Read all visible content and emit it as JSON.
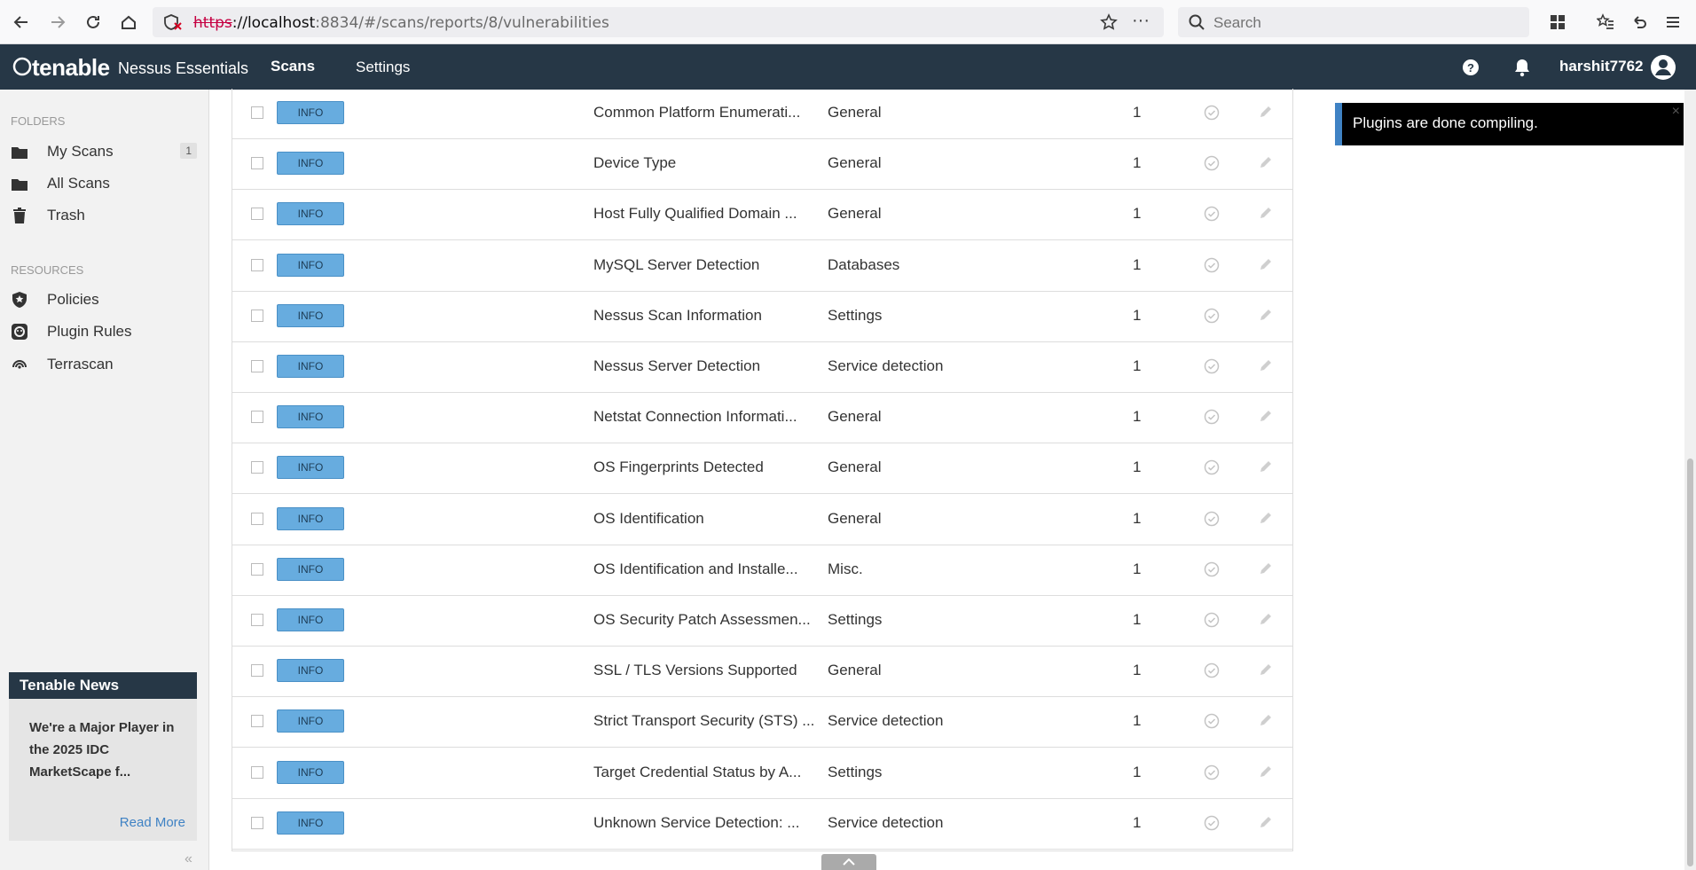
{
  "browser": {
    "url_scheme": "https",
    "url_host": "://localhost",
    "url_rest": ":8834/#/scans/reports/8/vulnerabilities",
    "search_placeholder": "Search"
  },
  "header": {
    "logo": "tenable",
    "product": "Nessus Essentials",
    "nav_scans": "Scans",
    "nav_settings": "Settings",
    "username": "harshit7762"
  },
  "sidebar": {
    "folders_label": "FOLDERS",
    "folders": [
      {
        "label": "My Scans",
        "badge": "1"
      },
      {
        "label": "All Scans"
      },
      {
        "label": "Trash"
      }
    ],
    "resources_label": "RESOURCES",
    "resources": [
      {
        "label": "Policies"
      },
      {
        "label": "Plugin Rules"
      },
      {
        "label": "Terrascan"
      }
    ]
  },
  "news": {
    "title": "Tenable News",
    "body": "We're a Major Player in the 2025 IDC MarketScape f...",
    "link": "Read More"
  },
  "toast": {
    "message": "Plugins are done compiling.",
    "close": "×"
  },
  "rows": [
    {
      "severity": "INFO",
      "name": "Common Platform Enumerati...",
      "family": "General",
      "count": "1"
    },
    {
      "severity": "INFO",
      "name": "Device Type",
      "family": "General",
      "count": "1"
    },
    {
      "severity": "INFO",
      "name": "Host Fully Qualified Domain ...",
      "family": "General",
      "count": "1"
    },
    {
      "severity": "INFO",
      "name": "MySQL Server Detection",
      "family": "Databases",
      "count": "1"
    },
    {
      "severity": "INFO",
      "name": "Nessus Scan Information",
      "family": "Settings",
      "count": "1"
    },
    {
      "severity": "INFO",
      "name": "Nessus Server Detection",
      "family": "Service detection",
      "count": "1"
    },
    {
      "severity": "INFO",
      "name": "Netstat Connection Informati...",
      "family": "General",
      "count": "1"
    },
    {
      "severity": "INFO",
      "name": "OS Fingerprints Detected",
      "family": "General",
      "count": "1"
    },
    {
      "severity": "INFO",
      "name": "OS Identification",
      "family": "General",
      "count": "1"
    },
    {
      "severity": "INFO",
      "name": "OS Identification and Installe...",
      "family": "Misc.",
      "count": "1"
    },
    {
      "severity": "INFO",
      "name": "OS Security Patch Assessmen...",
      "family": "Settings",
      "count": "1"
    },
    {
      "severity": "INFO",
      "name": "SSL / TLS Versions Supported",
      "family": "General",
      "count": "1"
    },
    {
      "severity": "INFO",
      "name": "Strict Transport Security (STS) ...",
      "family": "Service detection",
      "count": "1"
    },
    {
      "severity": "INFO",
      "name": "Target Credential Status by A...",
      "family": "Settings",
      "count": "1"
    },
    {
      "severity": "INFO",
      "name": "Unknown Service Detection: ...",
      "family": "Service detection",
      "count": "1"
    }
  ],
  "colors": {
    "header_bg": "#263746",
    "info_badge": "#67acdf",
    "link": "#3f82c4"
  }
}
